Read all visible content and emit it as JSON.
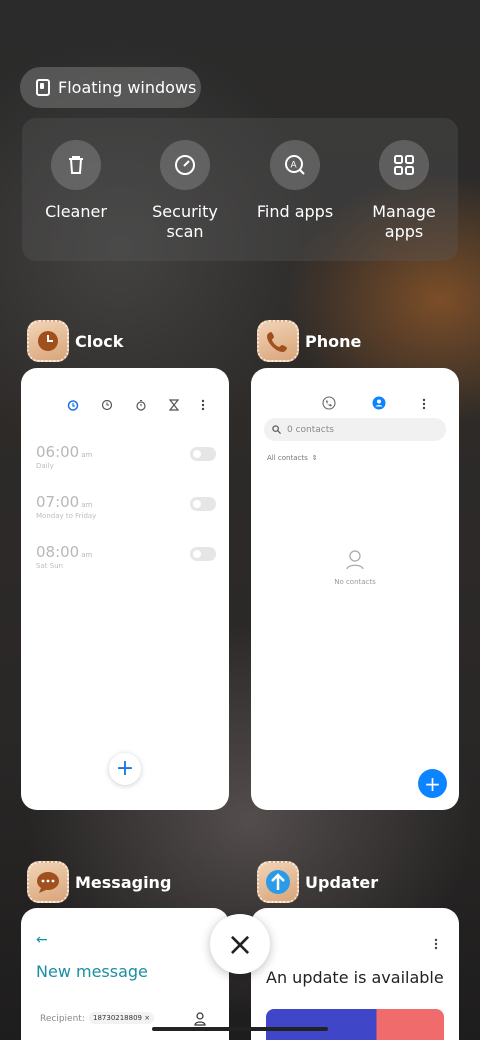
{
  "floating_windows": {
    "label": "Floating windows"
  },
  "quick_actions": [
    {
      "label": "Cleaner",
      "icon": "trash-icon"
    },
    {
      "label": "Security scan",
      "icon": "shield-check-icon"
    },
    {
      "label": "Find apps",
      "icon": "search-apps-icon"
    },
    {
      "label": "Manage apps",
      "icon": "grid-icon"
    }
  ],
  "apps": {
    "clock": {
      "name": "Clock",
      "alarms": [
        {
          "time": "06:00",
          "ampm": "am",
          "repeat": "Daily"
        },
        {
          "time": "07:00",
          "ampm": "am",
          "repeat": "Monday to Friday"
        },
        {
          "time": "08:00",
          "ampm": "am",
          "repeat": "Sat Sun"
        }
      ],
      "add_label": "+"
    },
    "phone": {
      "name": "Phone",
      "search_placeholder": "0 contacts",
      "filter_label": "All contacts",
      "empty_label": "No contacts",
      "add_label": "+"
    },
    "messaging": {
      "name": "Messaging",
      "back_label": "←",
      "title": "New message",
      "recipient_label": "Recipient:",
      "recipient_chip": "18730218809 ×"
    },
    "updater": {
      "name": "Updater",
      "title": "An update is available"
    }
  },
  "close_label": "×",
  "colors": {
    "accent": "#0d84ff",
    "teal": "#1a8fa3",
    "icon_bg": "#e2b48b"
  }
}
